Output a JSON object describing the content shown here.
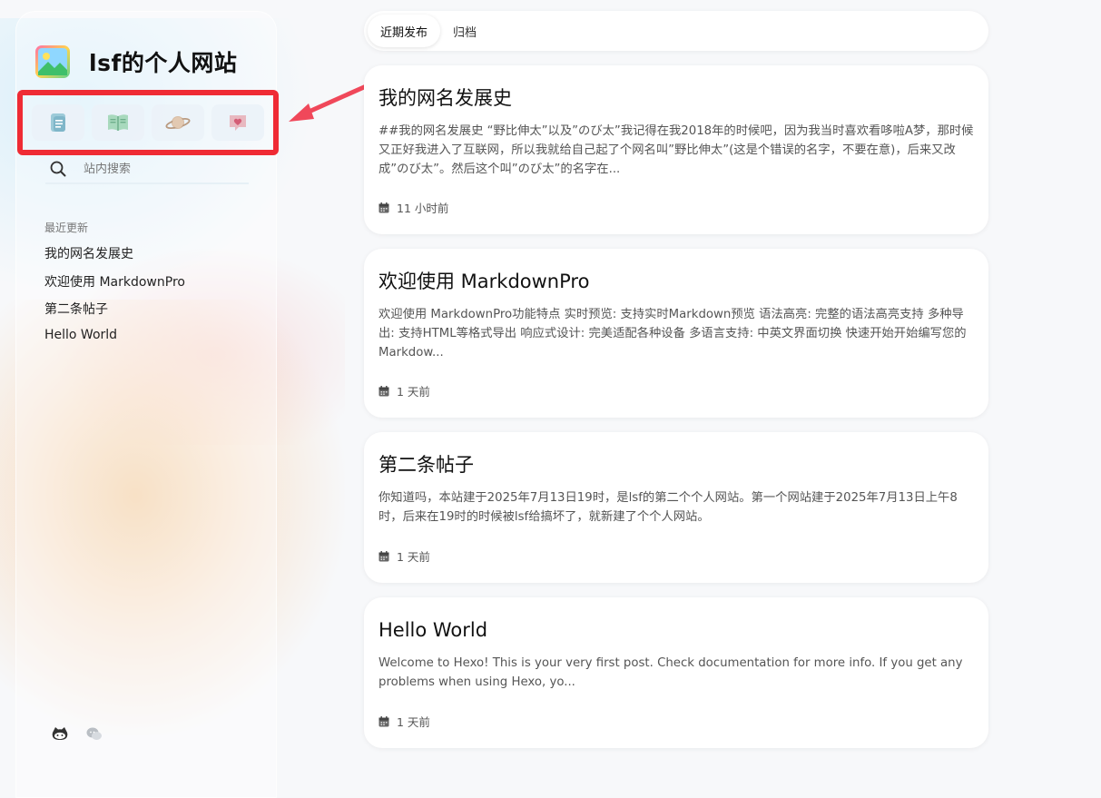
{
  "site": {
    "title": "lsf的个人网站"
  },
  "quick_nav": [
    {
      "icon": "document-icon",
      "color": "#7fb6c9"
    },
    {
      "icon": "book-icon",
      "color": "#8fc9a8"
    },
    {
      "icon": "planet-icon",
      "color": "#c7a98e"
    },
    {
      "icon": "heart-chat-icon",
      "color": "#d98a96"
    }
  ],
  "search": {
    "placeholder": "站内搜索"
  },
  "recent": {
    "title": "最近更新",
    "items": [
      "我的网名发展史",
      "欢迎使用 MarkdownPro",
      "第二条帖子",
      "Hello World"
    ]
  },
  "social": [
    "github-icon",
    "chat-icon"
  ],
  "tabs": [
    {
      "label": "近期发布",
      "active": true
    },
    {
      "label": "归档",
      "active": false
    }
  ],
  "posts": [
    {
      "title": "我的网名发展史",
      "excerpt": "##我的网名发展史 “野比伸太”以及”のび太”我记得在我2018年的时候吧，因为我当时喜欢看哆啦A梦，那时候又正好我进入了互联网，所以我就给自己起了个网名叫”野比伸太”(这是个错误的名字，不要在意)，后来又改成”のび太”。然后这个叫”のび太”的名字在...",
      "date": "11 小时前"
    },
    {
      "title": "欢迎使用 MarkdownPro",
      "excerpt": "欢迎使用 MarkdownPro功能特点 实时预览: 支持实时Markdown预览 语法高亮: 完整的语法高亮支持 多种导出: 支持HTML等格式导出 响应式设计: 完美适配各种设备 多语言支持: 中英文界面切换 快速开始开始编写您的Markdow...",
      "date": "1 天前"
    },
    {
      "title": "第二条帖子",
      "excerpt": "你知道吗，本站建于2025年7月13日19时，是lsf的第二个个人网站。第一个网站建于2025年7月13日上午8时，后来在19时的时候被lsf给搞坏了，就新建了个个人网站。",
      "date": "1 天前"
    },
    {
      "title": "Hello World",
      "excerpt": "Welcome to Hexo! This is your very first post. Check documentation for more info. If you get any problems when using Hexo, yo...",
      "date": "1 天前"
    }
  ],
  "colors": {
    "highlight_box": "#ef2b34",
    "annotation_arrow": "#f0485a"
  }
}
